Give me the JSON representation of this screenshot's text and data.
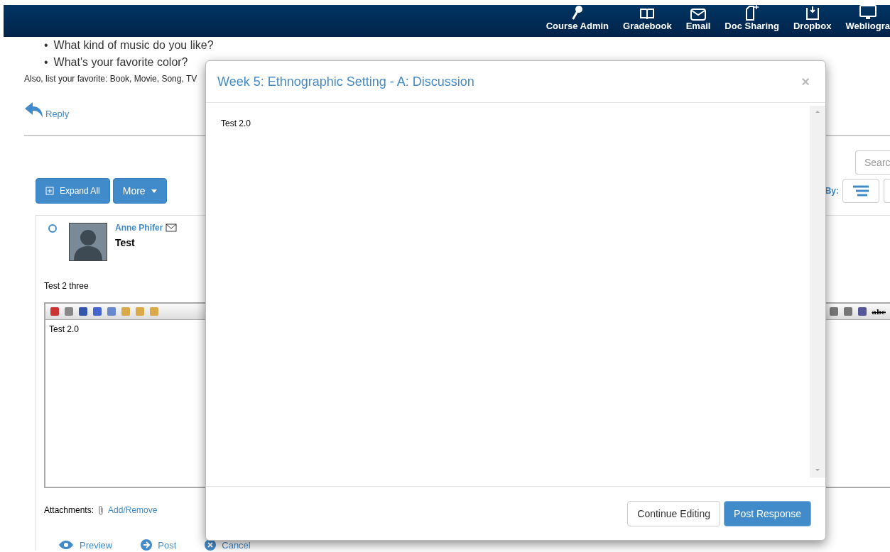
{
  "nav": {
    "items": [
      {
        "label": "Course Admin"
      },
      {
        "label": "Gradebook"
      },
      {
        "label": "Email"
      },
      {
        "label": "Doc Sharing"
      },
      {
        "label": "Dropbox"
      },
      {
        "label": "Webliogra"
      }
    ]
  },
  "prompt": {
    "marker": "•",
    "bullets": [
      "What kind of music do you like?",
      "What's your favorite color?"
    ],
    "note": "Also, list your favorite: Book, Movie, Song, TV"
  },
  "reply_link": "Reply",
  "search": {
    "placeholder": "Searc"
  },
  "controls": {
    "buttons": [
      {
        "label": "Expand All",
        "kind": "expand"
      },
      {
        "label": "More",
        "kind": "dropdown"
      }
    ],
    "sort_label": "By:"
  },
  "post": {
    "author": "Anne Phifer",
    "title": "Test",
    "body": "Test 2 three"
  },
  "editor": {
    "content": "Test 2.0",
    "strike_label": "abc"
  },
  "attachments": {
    "label": "Attachments:",
    "link": "Add/Remove"
  },
  "actions": [
    {
      "label": "Preview"
    },
    {
      "label": "Post"
    },
    {
      "label": "Cancel"
    }
  ],
  "modal": {
    "title": "Week 5: Ethnographic Setting - A: Discussion",
    "close": "×",
    "body": "Test 2.0",
    "buttons": [
      {
        "label": "Continue Editing",
        "primary": false
      },
      {
        "label": "Post Response",
        "primary": true
      }
    ]
  }
}
